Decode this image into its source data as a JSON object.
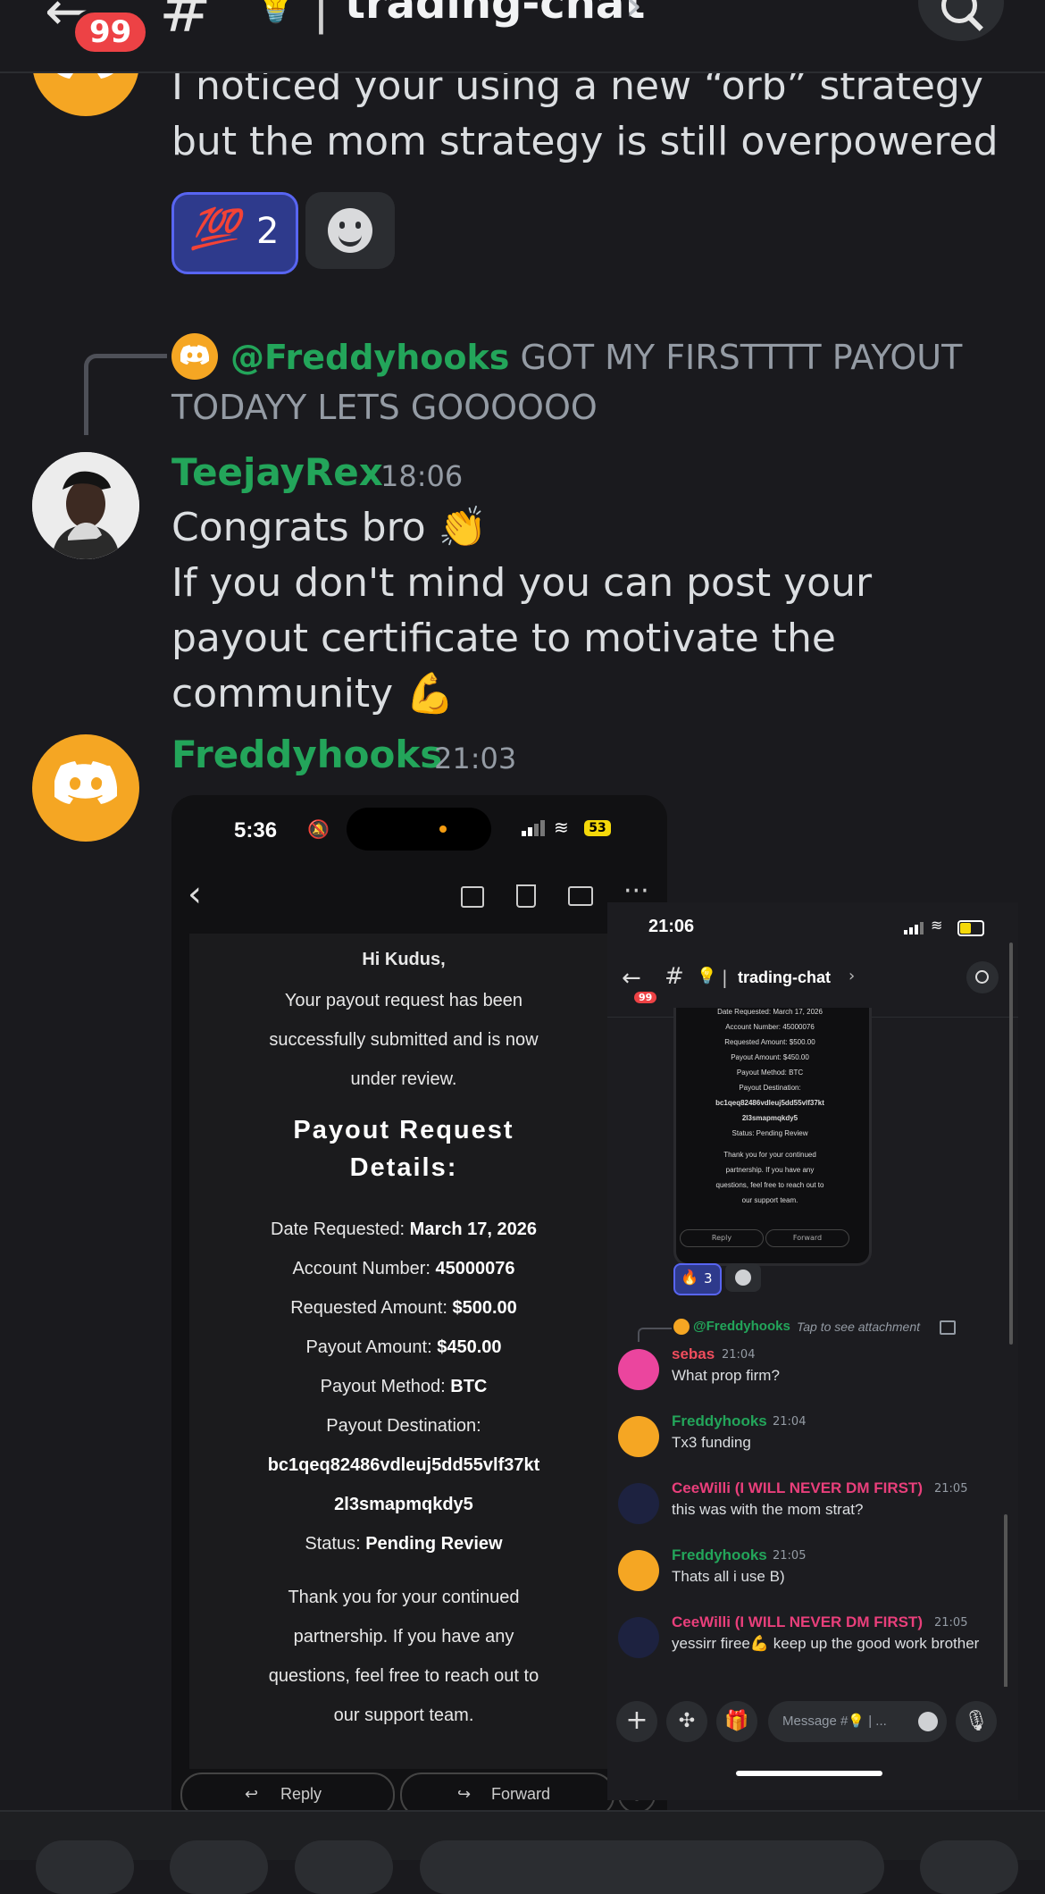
{
  "header": {
    "unread_badge": "99",
    "channel_hash": "#",
    "channel_emoji": "💡",
    "separator": "|",
    "channel_name": "trading-chat",
    "chevron": "›"
  },
  "messages": {
    "first": {
      "text": "I noticed your using a new “orb” strategy but the mom strategy is still overpowered",
      "reaction_emoji": "💯",
      "reaction_count": "2"
    },
    "reply_ref": {
      "mention": "@Freddyhooks",
      "text": "GOT MY FIRSTTTT PAYOUT TODAYY LETS GOOOOOO"
    },
    "teejay": {
      "username": "TeejayRex",
      "time": "18:06",
      "line1": "Congrats bro 👏",
      "line2": "If you don't mind you can post your payout certificate to motivate the community 💪"
    },
    "freddy": {
      "username": "Freddyhooks",
      "time": "21:03"
    }
  },
  "email_screenshot": {
    "time": "5:36",
    "battery": "53",
    "greeting": "Hi Kudus,",
    "intro_1": "Your payout request has been",
    "intro_2": "successfully submitted and is now",
    "intro_3": "under review.",
    "heading_1": "Payout Request",
    "heading_2": "Details:",
    "date_label": "Date Requested:",
    "date_value": "March 17, 2026",
    "account_label": "Account Number:",
    "account_value": "45000076",
    "requested_label": "Requested Amount:",
    "requested_value": "$500.00",
    "payout_label": "Payout Amount:",
    "payout_value": "$450.00",
    "method_label": "Payout Method:",
    "method_value": "BTC",
    "dest_label": "Payout Destination:",
    "dest_value_1": "bc1qeq82486vdleuj5dd55vlf37kt",
    "dest_value_2": "2l3smapmqkdy5",
    "status_label": "Status:",
    "status_value": "Pending Review",
    "outro_1": "Thank you for your continued",
    "outro_2": "partnership. If you have any",
    "outro_3": "questions, feel free to reach out to",
    "outro_4": "our support team.",
    "reply_btn": "Reply",
    "forward_btn": "Forward"
  },
  "chat_screenshot": {
    "time": "21:06",
    "badge": "99",
    "channel": "trading-chat",
    "mini_lines": [
      "Date Requested: March 17, 2026",
      "Account Number: 45000076",
      "Requested Amount: $500.00",
      "Payout Amount: $450.00",
      "Payout Method: BTC",
      "Payout Destination:",
      "bc1qeq82486vdleuj5dd55vlf37kt",
      "2l3smapmqkdy5",
      "Status: Pending Review",
      "Thank you for your continued",
      "partnership. If you have any",
      "questions, feel free to reach out to",
      "our support team."
    ],
    "mini_reply": "Reply",
    "mini_forward": "Forward",
    "reaction_count": "3",
    "reply_mention": "@Freddyhooks",
    "reply_hint": "Tap to see attachment",
    "messages": [
      {
        "user": "sebas",
        "time": "21:04",
        "text": "What prop firm?",
        "color": "#f04d5d"
      },
      {
        "user": "Freddyhooks",
        "time": "21:04",
        "text": "Tx3 funding",
        "color": "#23a55a"
      },
      {
        "user": "CeeWilli (I WILL NEVER DM FIRST)",
        "time": "21:05",
        "text": "this was with the mom strat?",
        "color": "#e93f7b"
      },
      {
        "user": "Freddyhooks",
        "time": "21:05",
        "text": "Thats all i use B)",
        "color": "#23a55a"
      },
      {
        "user": "CeeWilli (I WILL NEVER DM FIRST)",
        "time": "21:05",
        "text": "yessirr firee💪 keep up the good work brother",
        "color": "#e93f7b"
      }
    ],
    "message_placeholder": "Message #💡 | ..."
  }
}
